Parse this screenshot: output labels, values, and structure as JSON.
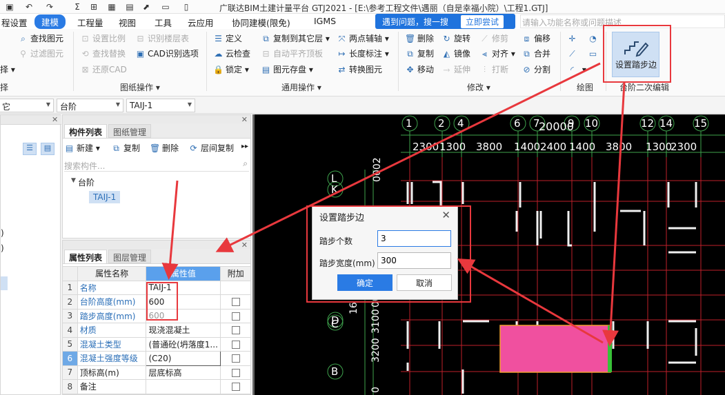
{
  "window": {
    "title": "广联达BIM土建计量平台 GTJ2021 - [E:\\参考工程文件\\遇丽（自是幸福小院）\\工程1.GTJ]",
    "qa_icons": [
      "save-icon",
      "undo-icon",
      "redo-icon",
      "sum-icon",
      "grid-icon",
      "table-icon",
      "view-icon",
      "export-icon"
    ]
  },
  "menu": {
    "items": [
      "程设置",
      "建模",
      "工程量",
      "视图",
      "工具",
      "云应用",
      "协同建模(限免)",
      "IGMS"
    ],
    "active": "建模",
    "tip_text": "遇到问题，搜一搜",
    "tip_button": "立即尝试",
    "search_placeholder": "请输入功能名称或问题描述"
  },
  "ribbon": {
    "col0": [
      "查找图元",
      "过滤图元",
      "择"
    ],
    "col0_group": "择",
    "drawing_ops": {
      "col1": [
        "设置比例",
        "查找替换",
        "还原CAD"
      ],
      "col2": [
        "识别楼层表",
        "CAD识别选项"
      ],
      "group": "图纸操作"
    },
    "general_ops": {
      "col1": [
        "定义",
        "云检查",
        "锁定"
      ],
      "col2": [
        "复制到其它层",
        "自动平齐顶板",
        "图元存盘"
      ],
      "col3": [
        "两点辅轴",
        "长度标注",
        "转换图元"
      ],
      "group": "通用操作"
    },
    "modify": {
      "col1": [
        "删除",
        "复制",
        "移动"
      ],
      "col2": [
        "旋转",
        "镜像",
        "延伸"
      ],
      "col3": [
        "修剪",
        "对齐",
        "打断"
      ],
      "col4": [
        "偏移",
        "合并",
        "分割"
      ],
      "group": "修改"
    },
    "draw": {
      "group": "绘图"
    },
    "step_edit": {
      "button": "设置踏步边",
      "group": "台阶二次编辑"
    }
  },
  "filterbar": {
    "sel0": "它",
    "sel1": "台阶",
    "sel2": "TAIJ-1"
  },
  "component_panel": {
    "tabs": [
      "构件列表",
      "图纸管理"
    ],
    "toolbar": [
      "新建",
      "复制",
      "删除",
      "层间复制"
    ],
    "search_placeholder": "搜索构件...",
    "tree_root": "台阶",
    "tree_item": "TAIJ-1"
  },
  "left_fragments": [
    ")",
    ")"
  ],
  "property_panel": {
    "tabs": [
      "属性列表",
      "图层管理"
    ],
    "headers": [
      "属性名称",
      "属性值",
      "附加"
    ],
    "rows": [
      {
        "n": "1",
        "name": "名称",
        "value": "TAIJ-1"
      },
      {
        "n": "2",
        "name": "台阶高度(mm)",
        "value": "600"
      },
      {
        "n": "3",
        "name": "踏步高度(mm)",
        "value": "600"
      },
      {
        "n": "4",
        "name": "材质",
        "value": "现浇混凝土"
      },
      {
        "n": "5",
        "name": "混凝土类型",
        "value": "(普通砼(坍落度1..."
      },
      {
        "n": "6",
        "name": "混凝土强度等级",
        "value": "(C20)"
      },
      {
        "n": "7",
        "name": "顶标高(m)",
        "value": "层底标高"
      },
      {
        "n": "8",
        "name": "备注",
        "value": ""
      }
    ]
  },
  "canvas": {
    "axis_numbers": [
      "1",
      "2",
      "4",
      "6",
      "7",
      "9",
      "10",
      "12",
      "14",
      "15"
    ],
    "total_dim": "20000",
    "dims_top": [
      "2300",
      "1300",
      "3800",
      "1400",
      "2400",
      "1400",
      "3800",
      "1300",
      "2300"
    ],
    "row_labels": [
      "L",
      "K",
      "D",
      "C",
      "B"
    ],
    "side_dims": [
      "0002",
      "16",
      "00",
      "3200",
      "3100",
      "0"
    ]
  },
  "dialog": {
    "title": "设置踏步边",
    "field1_label": "踏步个数",
    "field1_value": "3",
    "field2_label": "踏步宽度(mm)",
    "field2_value": "300",
    "ok": "确定",
    "cancel": "取消"
  },
  "colors": {
    "accent": "#2a7be4",
    "annotation": "#e8383d",
    "selection_fill": "#f0509f",
    "canvas_bg": "#000000"
  }
}
